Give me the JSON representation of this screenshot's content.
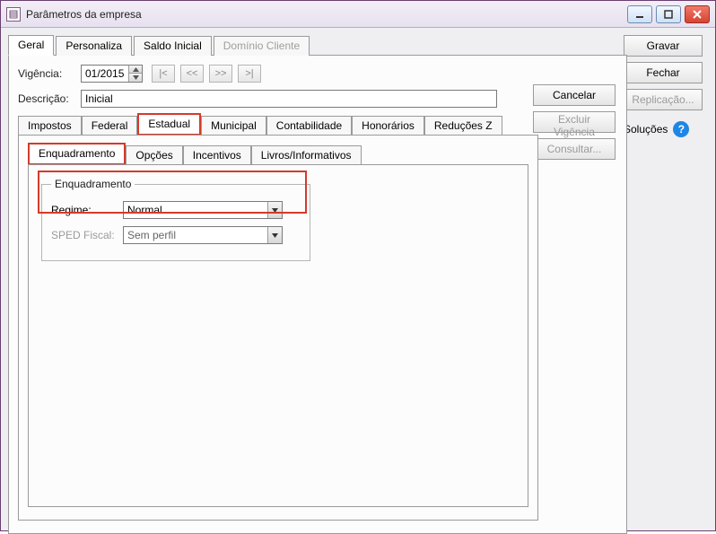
{
  "window": {
    "title": "Parâmetros da empresa"
  },
  "mainTabs": {
    "geral": "Geral",
    "personaliza": "Personaliza",
    "saldoInicial": "Saldo Inicial",
    "dominioCliente": "Domínio Cliente"
  },
  "fields": {
    "vigenciaLabel": "Vigência:",
    "vigenciaValue": "01/2015",
    "navFirst": "|<",
    "navPrev": "<<",
    "navNext": ">>",
    "navLast": ">|",
    "descricaoLabel": "Descrição:",
    "descricaoValue": "Inicial"
  },
  "panelActions": {
    "cancelar": "Cancelar",
    "excluirVigencia": "Excluir Vigência",
    "consultar": "Consultar..."
  },
  "rightCol": {
    "gravar": "Gravar",
    "fechar": "Fechar",
    "replicacao": "Replicação...",
    "solucoes": "Soluções"
  },
  "innerTabs": {
    "impostos": "Impostos",
    "federal": "Federal",
    "estadual": "Estadual",
    "municipal": "Municipal",
    "contabilidade": "Contabilidade",
    "honorarios": "Honorários",
    "reducoesZ": "Reduções Z"
  },
  "thirdTabs": {
    "enquadramento": "Enquadramento",
    "opcoes": "Opções",
    "incentivos": "Incentivos",
    "livrosInformativos": "Livros/Informativos"
  },
  "group": {
    "legend": "Enquadramento",
    "regimeLabel": "Regime:",
    "regimeValue": "Normal",
    "spedLabel": "SPED Fiscal:",
    "spedValue": "Sem perfil"
  }
}
